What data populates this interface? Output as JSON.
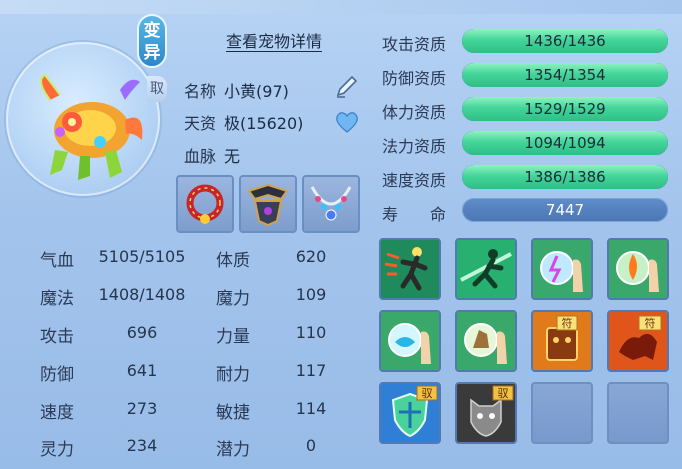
{
  "badge": {
    "bianyi": "变异",
    "side": "取"
  },
  "detail_link": "查看宠物详情",
  "info": {
    "name_label": "名称",
    "name_value": "小黄(97)",
    "aptitude_label": "天资",
    "aptitude_value": "极(15620)",
    "bloodline_label": "血脉",
    "bloodline_value": "无"
  },
  "equipment": [
    "ring-collar",
    "armor-plate",
    "gem-necklace"
  ],
  "stats": [
    {
      "label": "气血",
      "value": "5105/5105",
      "label2": "体质",
      "value2": "620"
    },
    {
      "label": "魔法",
      "value": "1408/1408",
      "label2": "魔力",
      "value2": "109"
    },
    {
      "label": "攻击",
      "value": "696",
      "label2": "力量",
      "value2": "110"
    },
    {
      "label": "防御",
      "value": "641",
      "label2": "耐力",
      "value2": "117"
    },
    {
      "label": "速度",
      "value": "273",
      "label2": "敏捷",
      "value2": "114"
    },
    {
      "label": "灵力",
      "value": "234",
      "label2": "潜力",
      "value2": "0"
    }
  ],
  "aptitudes": [
    {
      "label": "攻击资质",
      "value": "1436/1436",
      "fill": 1.0
    },
    {
      "label": "防御资质",
      "value": "1354/1354",
      "fill": 1.0
    },
    {
      "label": "体力资质",
      "value": "1529/1529",
      "fill": 1.0
    },
    {
      "label": "法力资质",
      "value": "1094/1094",
      "fill": 1.0
    },
    {
      "label": "速度资质",
      "value": "1386/1386",
      "fill": 1.0
    }
  ],
  "life": {
    "label": "寿　　命",
    "value": "7447"
  },
  "skills": [
    {
      "name": "runner-skill-icon"
    },
    {
      "name": "dash-skill-icon"
    },
    {
      "name": "lightning-palm-skill-icon"
    },
    {
      "name": "fire-palm-skill-icon"
    },
    {
      "name": "water-palm-skill-icon"
    },
    {
      "name": "earth-palm-skill-icon"
    },
    {
      "name": "talisman-mask-skill-icon",
      "tag": "符"
    },
    {
      "name": "talisman-beast-skill-icon",
      "tag": "符"
    },
    {
      "name": "shield-skill-icon",
      "tag": "驭"
    },
    {
      "name": "beast-head-skill-icon",
      "tag": "驭"
    }
  ],
  "colors": {
    "bar_fill": "#44d59a",
    "bar_track": "#3f6fa8",
    "life_bar": "#5f8dca",
    "text": "#26354d"
  }
}
